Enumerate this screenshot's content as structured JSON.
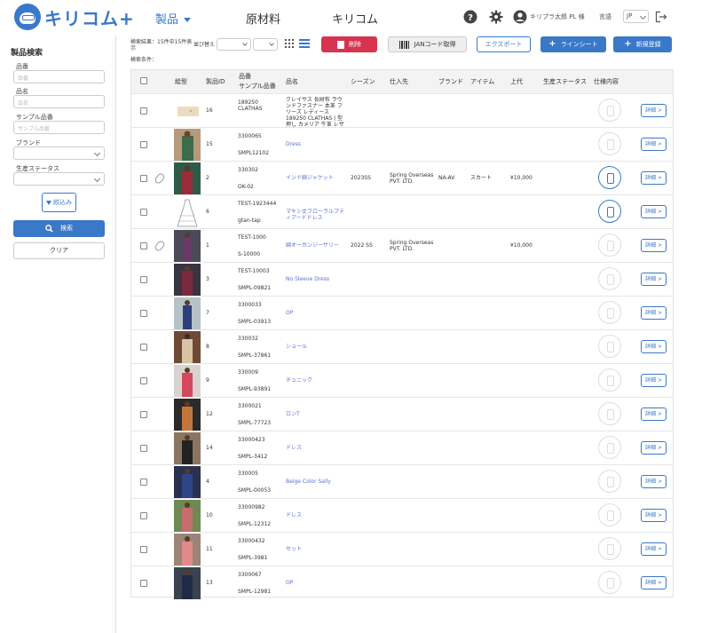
{
  "header": {
    "logo_text": "キリコム+",
    "nav": [
      "製品",
      "原材料",
      "キリコム"
    ],
    "user_name": "キリプラ太郎 PL 様",
    "lang_label": "言語",
    "lang_value": "JP"
  },
  "sidebar": {
    "title": "製品検索",
    "fields": [
      {
        "label": "品番",
        "placeholder": "品番"
      },
      {
        "label": "品名",
        "placeholder": "品名"
      },
      {
        "label": "サンプル品番",
        "placeholder": "サンプル品番"
      },
      {
        "label": "ブランド"
      },
      {
        "label": "生産ステータス"
      }
    ],
    "narrow_button": "絞込み",
    "search_button": "検索",
    "clear_button": "クリア"
  },
  "toolbar": {
    "result_text": "検索結果：15件中15件表示",
    "sort_label": "並び替え",
    "condition_label": "検索条件：",
    "delete_button": "削除",
    "jan_button": "JANコード取得",
    "export_button": "エクスポート",
    "linesheet_button": "ラインシート",
    "new_button": "新規登録"
  },
  "table": {
    "headers": {
      "image": "絵型",
      "product_id": "製品ID",
      "item_no": "品番",
      "sample_no": "サンプル品番",
      "name": "品名",
      "season": "シーズン",
      "supplier": "仕入先",
      "brand": "ブランド",
      "item": "アイテム",
      "price": "上代",
      "status": "生産ステータス",
      "spec": "仕様内容"
    },
    "detail_label": "詳細 >",
    "rows": [
      {
        "id": "16",
        "item_no": "189250 CLATHAS",
        "sample_no": "",
        "name": "クレイサス 長財布 ラウンドファスナー 本革 フリーズ レディース 189250 CLATHAS | 型押し カメリア 牛革 レザー",
        "season": "",
        "supplier": "",
        "brand": "",
        "item": "",
        "price": "",
        "clip": false,
        "spec_on": false,
        "img": "wallet",
        "name_link": false
      },
      {
        "id": "15",
        "item_no": "3300065",
        "sample_no": "SMPL12102",
        "name": "Dress",
        "season": "",
        "supplier": "",
        "brand": "",
        "item": "",
        "price": "",
        "clip": false,
        "spec_on": false,
        "img": "dress-green",
        "name_link": true
      },
      {
        "id": "2",
        "item_no": "330302",
        "sample_no": "OK-02",
        "name": "インド綿ジャケット",
        "season": "2023SS",
        "supplier": "Spring Overseas PVT. LTD.",
        "brand": "NA-AV",
        "item": "スカート",
        "price": "¥10,000",
        "clip": true,
        "spec_on": true,
        "img": "dress-red-green",
        "name_link": true
      },
      {
        "id": "6",
        "item_no": "TEST-1923444",
        "sample_no": "gtan-tap",
        "name": "マキシ丈フローラルプティアードドレス",
        "season": "",
        "supplier": "",
        "brand": "",
        "item": "",
        "price": "",
        "clip": false,
        "spec_on": true,
        "img": "sketch",
        "name_link": true
      },
      {
        "id": "1",
        "item_no": "TEST-1000",
        "sample_no": "S-10000",
        "name": "綿オーガンジーサリー",
        "season": "2022 SS",
        "supplier": "Spring Overseas PVT. LTD.",
        "brand": "",
        "item": "",
        "price": "¥10,000",
        "clip": true,
        "spec_on": false,
        "img": "saree-dark",
        "name_link": true
      },
      {
        "id": "3",
        "item_no": "TEST-10003",
        "sample_no": "SMPL-09821",
        "name": "No Sleeve Dress",
        "season": "",
        "supplier": "",
        "brand": "",
        "item": "",
        "price": "",
        "clip": false,
        "spec_on": false,
        "img": "saree-maroon",
        "name_link": true
      },
      {
        "id": "7",
        "item_no": "3300033",
        "sample_no": "SMPL-03913",
        "name": "OP",
        "season": "",
        "supplier": "",
        "brand": "",
        "item": "",
        "price": "",
        "clip": false,
        "spec_on": false,
        "img": "dress-blue-arch",
        "name_link": true
      },
      {
        "id": "8",
        "item_no": "330032",
        "sample_no": "SMPL-37861",
        "name": "ショール",
        "season": "",
        "supplier": "",
        "brand": "",
        "item": "",
        "price": "",
        "clip": false,
        "spec_on": false,
        "img": "shawl-brown",
        "name_link": true
      },
      {
        "id": "9",
        "item_no": "330009",
        "sample_no": "SMPL-93891",
        "name": "チュニック",
        "season": "",
        "supplier": "",
        "brand": "",
        "item": "",
        "price": "",
        "clip": false,
        "spec_on": false,
        "img": "tunic-pink",
        "name_link": true
      },
      {
        "id": "12",
        "item_no": "3300021",
        "sample_no": "SMPL-77723",
        "name": "ロンT",
        "season": "",
        "supplier": "",
        "brand": "",
        "item": "",
        "price": "",
        "clip": false,
        "spec_on": false,
        "img": "long-t",
        "name_link": true
      },
      {
        "id": "14",
        "item_no": "33000423",
        "sample_no": "SMPL-3412",
        "name": "ドレス",
        "season": "",
        "supplier": "",
        "brand": "",
        "item": "",
        "price": "",
        "clip": false,
        "spec_on": false,
        "img": "dress-black",
        "name_link": true
      },
      {
        "id": "4",
        "item_no": "330005",
        "sample_no": "SMPL-00053",
        "name": "Beige Color Sally",
        "season": "",
        "supplier": "",
        "brand": "",
        "item": "",
        "price": "",
        "clip": false,
        "spec_on": false,
        "img": "saree-navy",
        "name_link": true
      },
      {
        "id": "10",
        "item_no": "33000982",
        "sample_no": "SMPL-12312",
        "name": "ドレス",
        "season": "",
        "supplier": "",
        "brand": "",
        "item": "",
        "price": "",
        "clip": false,
        "spec_on": false,
        "img": "dress-field",
        "name_link": true
      },
      {
        "id": "11",
        "item_no": "33000432",
        "sample_no": "SMPL-3981",
        "name": "セット",
        "season": "",
        "supplier": "",
        "brand": "",
        "item": "",
        "price": "",
        "clip": false,
        "spec_on": false,
        "img": "set-pink",
        "name_link": true
      },
      {
        "id": "13",
        "item_no": "3300067",
        "sample_no": "SMPL-12981",
        "name": "OP",
        "season": "",
        "supplier": "",
        "brand": "",
        "item": "",
        "price": "",
        "clip": false,
        "spec_on": false,
        "img": "op-dark",
        "name_link": true
      }
    ]
  },
  "colors": {
    "accent": "#3a78c8",
    "danger": "#d6344f",
    "link": "#5b6fd6"
  }
}
